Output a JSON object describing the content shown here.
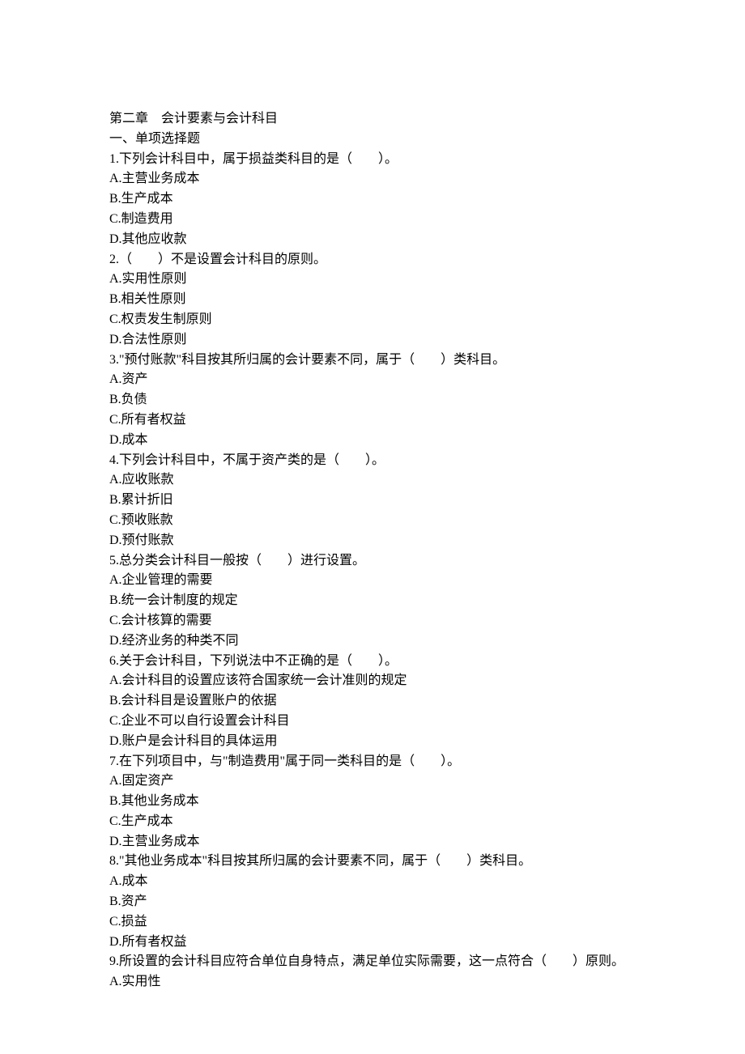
{
  "chapter_title": "第二章　会计要素与会计科目",
  "section_title": "一、单项选择题",
  "questions": [
    {
      "stem": "1.下列会计科目中，属于损益类科目的是（　　）。",
      "options": [
        "A.主营业务成本",
        "B.生产成本",
        "C.制造费用",
        "D.其他应收款"
      ]
    },
    {
      "stem": "2.（　　）不是设置会计科目的原则。",
      "options": [
        "A.实用性原则",
        "B.相关性原则",
        "C.权责发生制原则",
        "D.合法性原则"
      ]
    },
    {
      "stem": "3.\"预付账款\"科目按其所归属的会计要素不同，属于（　　）类科目。",
      "options": [
        "A.资产",
        "B.负债",
        "C.所有者权益",
        "D.成本"
      ]
    },
    {
      "stem": "4.下列会计科目中，不属于资产类的是（　　）。",
      "options": [
        "A.应收账款",
        "B.累计折旧",
        "C.预收账款",
        "D.预付账款"
      ]
    },
    {
      "stem": "5.总分类会计科目一般按（　　）进行设置。",
      "options": [
        "A.企业管理的需要",
        "B.统一会计制度的规定",
        "C.会计核算的需要",
        "D.经济业务的种类不同"
      ]
    },
    {
      "stem": "6.关于会计科目，下列说法中不正确的是（　　）。",
      "options": [
        "A.会计科目的设置应该符合国家统一会计准则的规定",
        "B.会计科目是设置账户的依据",
        "C.企业不可以自行设置会计科目",
        "D.账户是会计科目的具体运用"
      ]
    },
    {
      "stem": "7.在下列项目中，与\"制造费用\"属于同一类科目的是（　　）。",
      "options": [
        "A.固定资产",
        "B.其他业务成本",
        "C.生产成本",
        "D.主营业务成本"
      ]
    },
    {
      "stem": "8.\"其他业务成本\"科目按其所归属的会计要素不同，属于（　　）类科目。",
      "options": [
        "A.成本",
        "B.资产",
        "C.损益",
        "D.所有者权益"
      ]
    },
    {
      "stem": "9.所设置的会计科目应符合单位自身特点，满足单位实际需要，这一点符合（　　）原则。",
      "options": [
        "A.实用性"
      ]
    }
  ]
}
